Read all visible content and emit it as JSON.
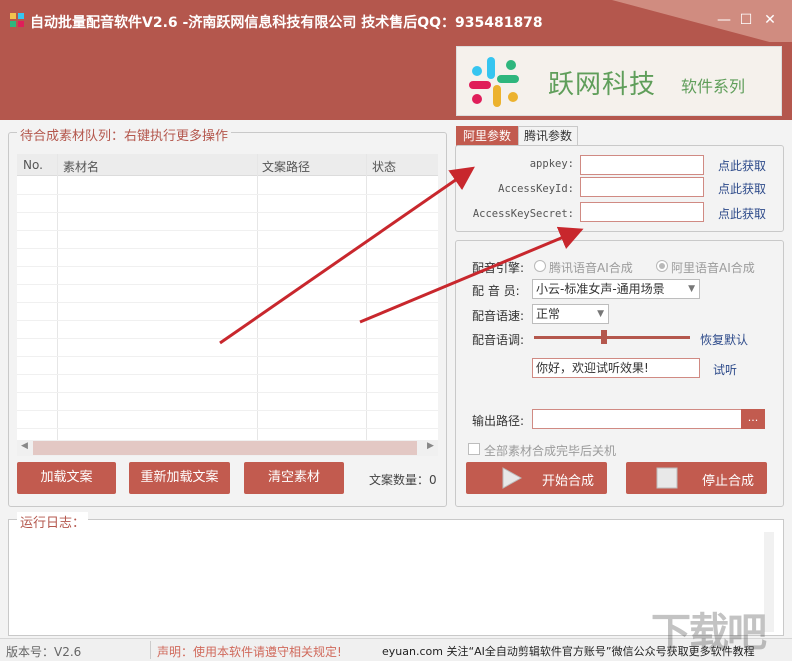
{
  "window": {
    "title": "自动批量配音软件V2.6 -济南跃网信息科技有限公司 技术售后QQ：935481878",
    "minimize_glyph": "—",
    "maximize_glyph": "☐",
    "close_glyph": "✕"
  },
  "banner": {
    "brand": "跃网科技",
    "series": "软件系列"
  },
  "queue": {
    "title": "待合成素材队列：右键执行更多操作",
    "columns": [
      "No.",
      "素材名",
      "文案路径",
      "状态"
    ]
  },
  "buttons": {
    "load": "加载文案",
    "reload": "重新加载文案",
    "clear": "清空素材",
    "count_label": "文案数量：0"
  },
  "tabs": [
    {
      "label": "阿里参数",
      "active": true
    },
    {
      "label": "腾讯参数",
      "active": false
    }
  ],
  "ali_params": [
    {
      "label": "appkey:",
      "value": "",
      "link": "点此获取"
    },
    {
      "label": "AccessKeyId:",
      "value": "",
      "link": "点此获取"
    },
    {
      "label": "AccessKeySecret:",
      "value": "",
      "link": "点此获取"
    }
  ],
  "voice": {
    "engine_label": "配音引擎:",
    "engine_options": [
      "腾讯语音AI合成",
      "阿里语音AI合成"
    ],
    "engine_selected": "阿里语音AI合成",
    "speaker_label": "配 音 员:",
    "speaker_value": "小云-标准女声-通用场景",
    "speed_label": "配音语速:",
    "speed_value": "正常",
    "pitch_label": "配音语调:",
    "pitch_level": 0.45,
    "reset_label": "恢复默认",
    "test_text": "你好，欢迎试听效果!",
    "test_button": "试听",
    "output_label": "输出路径:",
    "output_value": "",
    "browse": "...",
    "shutdown_label": "全部素材合成完毕后关机",
    "shutdown_checked": false
  },
  "actions": {
    "start": "开始合成",
    "stop": "停止合成"
  },
  "log": {
    "title": "运行日志："
  },
  "status": {
    "version": "版本号：V2.6",
    "notice": "声明：使用本软件请遵守相关规定!",
    "promo": "eyuan.com 关注“AI全自动剪辑软件官方账号”微信公众号获取更多软件教程"
  },
  "watermark": "下载吧",
  "colors": {
    "brand": "#b4574d",
    "button": "#c25b4f",
    "link": "#2d4a8a",
    "annotation_arrow": "#c8272d"
  }
}
